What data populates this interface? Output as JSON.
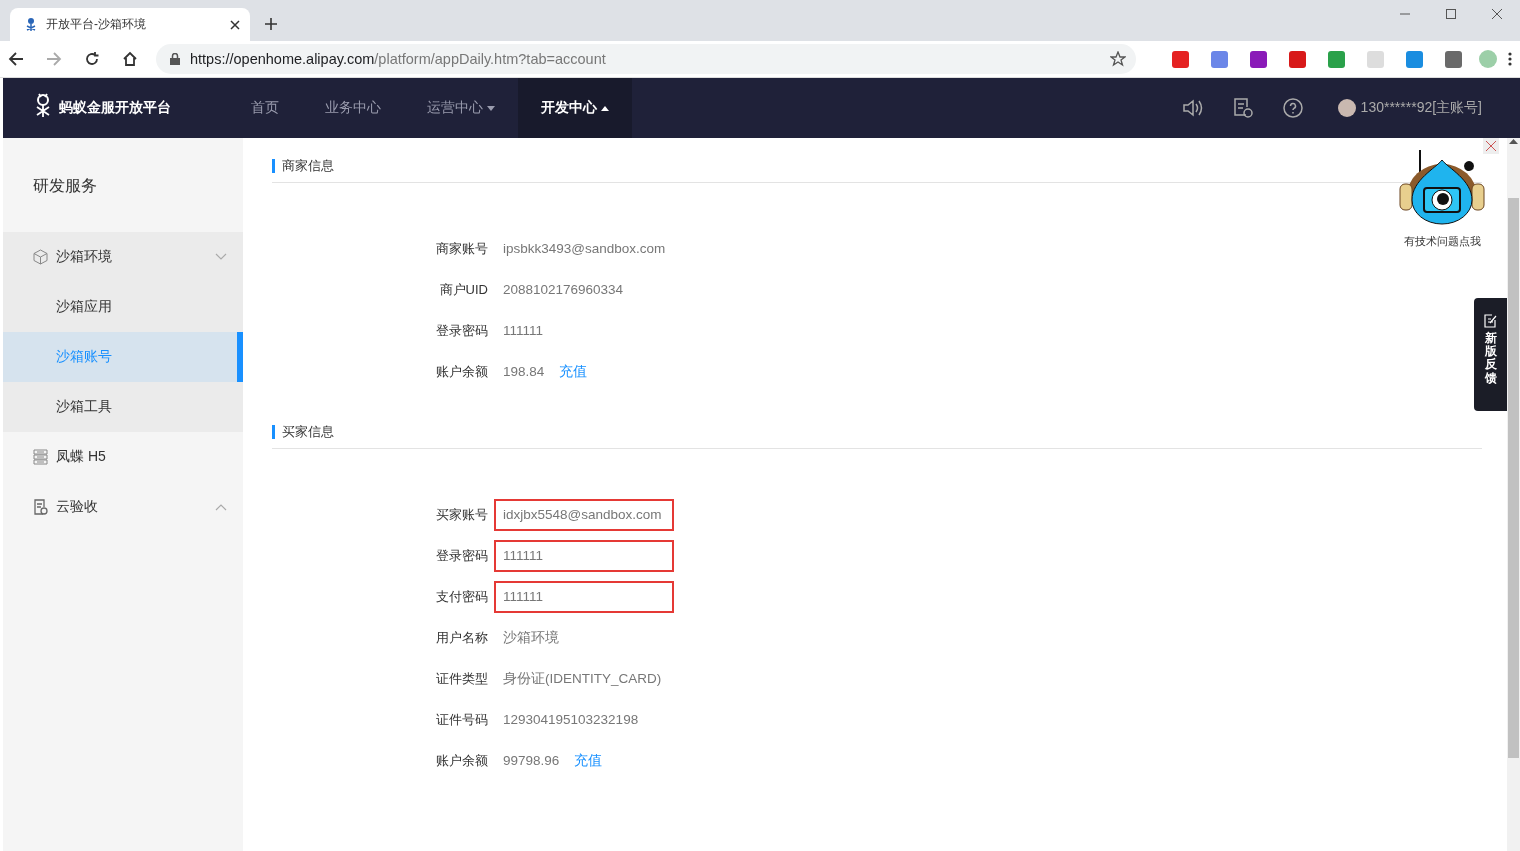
{
  "browser": {
    "tab_title": "开放平台-沙箱环境",
    "url_host": "https://openhome.alipay.com",
    "url_path": "/platform/appDaily.htm?tab=account"
  },
  "nav": {
    "brand": "蚂蚁金服开放平台",
    "items": [
      {
        "label": "首页",
        "selected": false,
        "kind": "plain"
      },
      {
        "label": "业务中心",
        "selected": false,
        "kind": "plain"
      },
      {
        "label": "运营中心",
        "selected": false,
        "kind": "menu",
        "expanded": false
      },
      {
        "label": "开发中心",
        "selected": true,
        "kind": "menu",
        "expanded": true
      }
    ],
    "user": "130******92[主账号]"
  },
  "sidebar": {
    "title": "研发服务",
    "items": [
      {
        "label": "沙箱环境",
        "kind": "group",
        "expanded": true,
        "children": [
          {
            "label": "沙箱应用",
            "selected": false
          },
          {
            "label": "沙箱账号",
            "selected": true
          },
          {
            "label": "沙箱工具",
            "selected": false
          }
        ]
      },
      {
        "label": "凤蝶 H5",
        "kind": "link"
      },
      {
        "label": "云验收",
        "kind": "group",
        "expanded": false
      }
    ]
  },
  "sections": [
    {
      "title": "商家信息",
      "rows": [
        {
          "label": "商家账号",
          "value": "ipsbkk3493@sandbox.com",
          "highlighted": false
        },
        {
          "label": "商户UID",
          "value": "2088102176960334",
          "highlighted": false
        },
        {
          "label": "登录密码",
          "value": "111111",
          "highlighted": false
        },
        {
          "label": "账户余额",
          "value": "198.84",
          "highlighted": false,
          "link": "充值"
        }
      ]
    },
    {
      "title": "买家信息",
      "rows": [
        {
          "label": "买家账号",
          "value": "idxjbx5548@sandbox.com",
          "highlighted": true
        },
        {
          "label": "登录密码",
          "value": "111111",
          "highlighted": true
        },
        {
          "label": "支付密码",
          "value": "111111",
          "highlighted": true
        },
        {
          "label": "用户名称",
          "value": "沙箱环境",
          "highlighted": false
        },
        {
          "label": "证件类型",
          "value": "身份证(IDENTITY_CARD)",
          "highlighted": false
        },
        {
          "label": "证件号码",
          "value": "129304195103232198",
          "highlighted": false
        },
        {
          "label": "账户余额",
          "value": "99798.96",
          "highlighted": false,
          "link": "充值"
        }
      ]
    }
  ],
  "helper": {
    "label": "有技术问题点我"
  },
  "feedback": {
    "label": "新版反馈"
  }
}
